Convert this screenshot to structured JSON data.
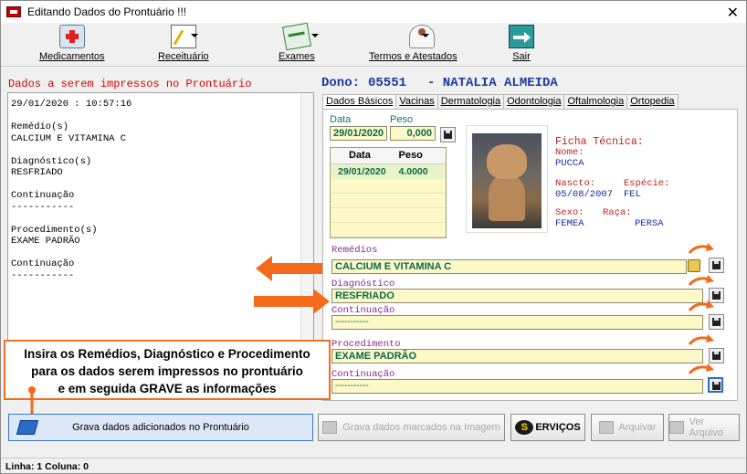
{
  "window": {
    "title": "Editando Dados do Prontuário !!!",
    "close": "✕"
  },
  "toolbar": {
    "medicamentos": "Medicamentos",
    "receituario": "Receituário",
    "exames": "Exames",
    "termos": "Termos e Atestados",
    "sair": "Sair"
  },
  "left": {
    "heading": "Dados a serem impressos no Prontuário",
    "memo_lines": [
      "29/01/2020 : 10:57:16",
      "",
      "Remédio(s)",
      "CALCIUM E VITAMINA C",
      "",
      "Diagnóstico(s)",
      "RESFRIADO",
      "",
      "Continuação",
      "-----------",
      "",
      "Procedimento(s)",
      "EXAME PADRÃO",
      "",
      "Continuação",
      "-----------"
    ]
  },
  "dono": {
    "label": "Dono:",
    "id": "05551",
    "name": "- NATALIA ALMEIDA"
  },
  "tabs": [
    "Dados Básicos",
    "Vacinas",
    "Dermatologia",
    "Odontologia",
    "Oftalmologia",
    "Ortopedia"
  ],
  "basic": {
    "data_label": "Data",
    "peso_label": "Peso",
    "data_value": "29/01/2020",
    "peso_value": "0,000",
    "grid": {
      "headers": [
        "Data",
        "Peso"
      ],
      "rows": [
        {
          "data": "29/01/2020",
          "peso": "4.0000"
        }
      ]
    }
  },
  "ficha": {
    "title": "Ficha Técnica:",
    "nome_label": "Nome:",
    "nome": "PUCCA",
    "nasc_label": "Nascto:",
    "especie_label": "Espécie:",
    "nasc": "05/08/2007",
    "especie": "FEL",
    "sexo_label": "Sexo:",
    "raca_label": "Raça:",
    "sexo": "FEMEA",
    "raca": "PERSA"
  },
  "fields": {
    "remedios_label": "Remédios",
    "remedios_value": "CALCIUM E VITAMINA C",
    "diagnostico_label": "Diagnóstico",
    "diagnostico_value": "RESFRIADO",
    "continuacao1_label": "Continuação",
    "continuacao1_value": "-----------",
    "procedimento_label": "Procedimento",
    "procedimento_value": "EXAME PADRÃO",
    "continuacao2_label": "Continuação",
    "continuacao2_value": "-----------"
  },
  "overlay": {
    "line1": "Insira os Remédios, Diagnóstico e Procedimento",
    "line2": "para os dados serem impressos no prontuário",
    "line3": "e em seguida GRAVE as informações"
  },
  "buttons": {
    "grava": "Grava dados adicionados no Prontuário",
    "grava_marcados": "Grava dados marcados na Imagem",
    "servicos": "ERVIÇOS",
    "servicos_badge": "S",
    "arquivar": "Arquivar",
    "ver_arquivo": "Ver Arquivo"
  },
  "status": {
    "text": "Linha: 1 Coluna: 0"
  },
  "colors": {
    "accent_orange": "#f46a1a",
    "label_red": "#c02020",
    "label_blue": "#1a2aa0",
    "field_yellow": "#fcf8c8"
  }
}
